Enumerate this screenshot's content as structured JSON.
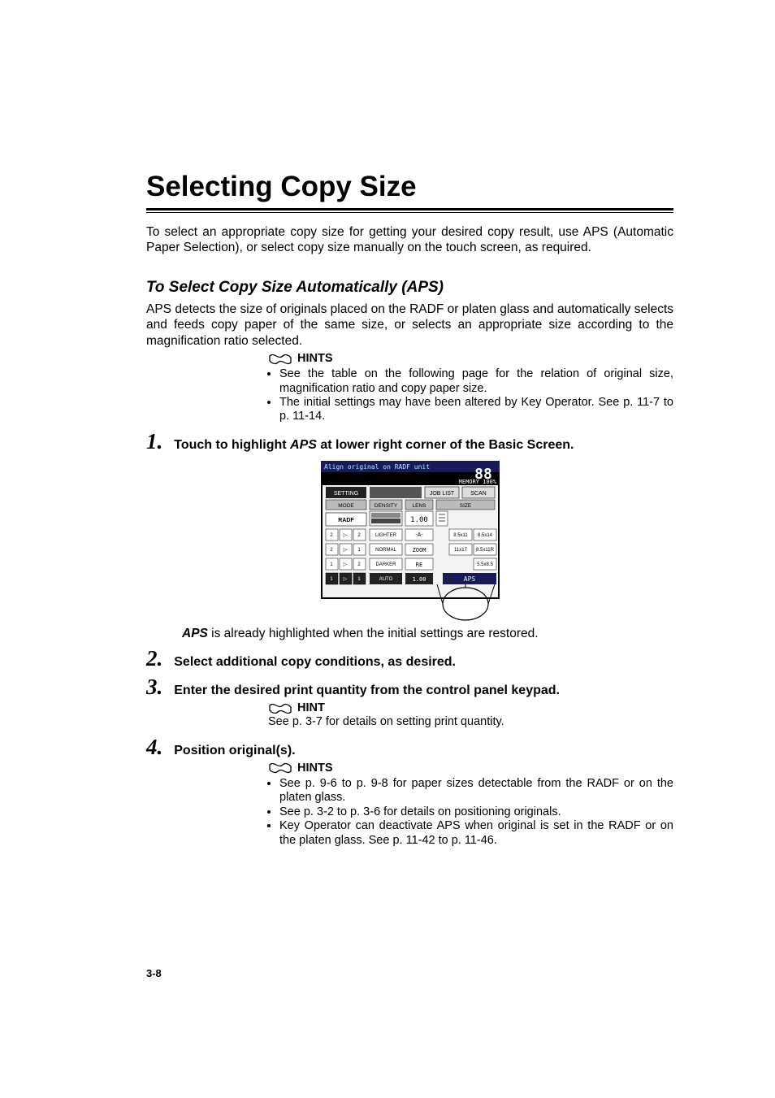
{
  "title": "Selecting Copy Size",
  "intro": "To select an appropriate copy size for getting your desired copy result, use APS (Automatic Paper Selection), or select copy size manually on the touch screen, as required.",
  "section_heading": "To Select Copy Size Automatically (APS)",
  "section_body": "APS detects the size of originals placed on the RADF or platen glass and automatically selects and feeds copy paper of the same size, or selects an appropriate size according to the magnification ratio selected.",
  "hints1": {
    "label": "HINTS",
    "items": [
      "See the table on the following page for the relation of original size, magnification ratio and copy paper size.",
      "The initial settings may have been altered by Key Operator. See p. 11-7 to p. 11-14."
    ]
  },
  "steps": {
    "s1": {
      "num": "1.",
      "pre": "Touch to highlight ",
      "aps": "APS",
      "post": " at lower right corner of the Basic Screen."
    },
    "after_shot": {
      "aps": "APS",
      "rest": " is already highlighted when the initial settings are restored."
    },
    "s2": {
      "num": "2.",
      "text": "Select additional copy conditions, as desired."
    },
    "s3": {
      "num": "3.",
      "text": "Enter the desired print quantity from the control panel keypad."
    },
    "s4": {
      "num": "4.",
      "text": "Position original(s)."
    }
  },
  "hint2": {
    "label": "HINT",
    "text": "See p. 3-7 for details on setting print quantity."
  },
  "hints3": {
    "label": "HINTS",
    "items": [
      "See p. 9-6 to p. 9-8 for paper sizes detectable from the RADF or on the platen glass.",
      "See p. 3-2 to p. 3-6 for details on positioning originals.",
      "Key Operator can deactivate APS when original is set in the RADF or on the platen glass. See p. 11-42 to p. 11-46."
    ]
  },
  "page_number": "3-8",
  "screenshot": {
    "status_bar": "Align original on RADF unit",
    "memory": "MEMORY 100%",
    "big_number": "88",
    "tool_tab": "SETTING",
    "job_list": "JOB LIST",
    "scan": "SCAN",
    "col_mode": "MODE",
    "col_density": "DENSITY",
    "col_lens": "LENS",
    "col_size": "SIZE",
    "radf": "RADF",
    "lighter": "LIGHTER",
    "normal": "NORMAL",
    "darker": "DARKER",
    "auto": "AUTO",
    "lens_100": "1.00",
    "a_dash": "-A-",
    "zoom": "ZOOM",
    "re": "RE",
    "lens_bottom": "1.00",
    "tray1": "8.5x11",
    "tray2": "8.5x14",
    "tray3": "11x17",
    "tray4": "8.5x11R",
    "tray5": "5.5x8.5",
    "aps": "APS"
  }
}
